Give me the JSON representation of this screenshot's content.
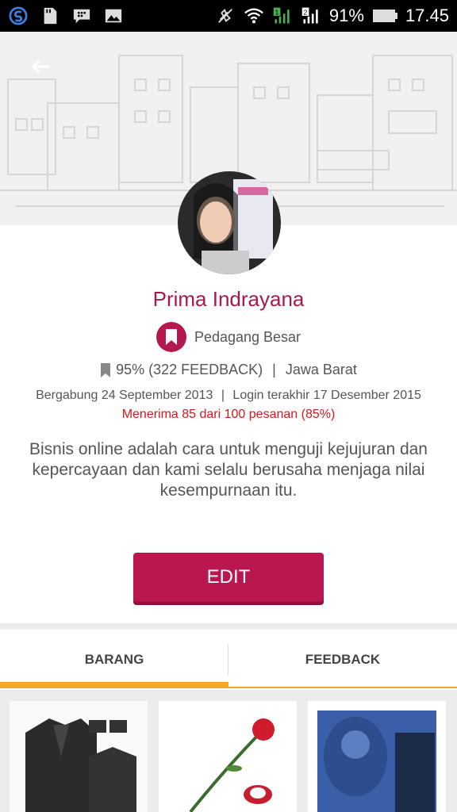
{
  "status": {
    "battery_pct": "91%",
    "time": "17.45",
    "sim1": "1",
    "sim2": "2"
  },
  "profile": {
    "name": "Prima Indrayana",
    "level": "Pedagang Besar",
    "feedback": "95% (322 FEEDBACK)",
    "separator": "|",
    "region": "Jawa Barat",
    "joined": "Bergabung 24 September 2013",
    "last_login": "Login terakhir 17 Desember 2015",
    "acceptance": "Menerima 85 dari 100 pesanan (85%)",
    "bio": "Bisnis online adalah cara untuk menguji kejujuran dan kepercayaan dan kami selalu berusaha menjaga nilai kesempurnaan itu."
  },
  "actions": {
    "edit": "EDIT"
  },
  "tabs": [
    {
      "label": "BARANG",
      "active": true
    },
    {
      "label": "FEEDBACK",
      "active": false
    }
  ],
  "colors": {
    "accent": "#b8174f",
    "tab_indicator": "#f5a623",
    "acceptance_text": "#d11a1a"
  }
}
